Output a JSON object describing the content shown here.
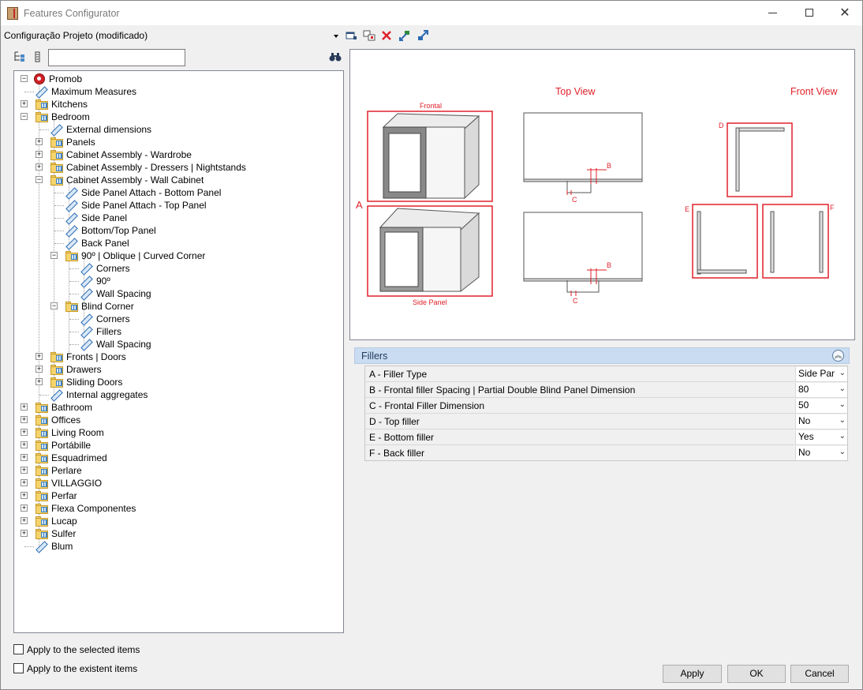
{
  "window": {
    "title": "Features Configurator"
  },
  "toolbar": {
    "profile": "Configuração Projeto (modificado)",
    "icons": [
      "configure-icon",
      "copy-icon",
      "delete-icon",
      "import-icon",
      "export-icon"
    ]
  },
  "search": {
    "value": "",
    "placeholder": ""
  },
  "tree": {
    "root": "Promob",
    "items": [
      {
        "label": "Maximum Measures"
      },
      {
        "label": "Kitchens"
      },
      {
        "label": "Bedroom"
      },
      {
        "label": "External dimensions"
      },
      {
        "label": "Panels"
      },
      {
        "label": "Cabinet Assembly - Wardrobe"
      },
      {
        "label": "Cabinet Assembly - Dressers | Nightstands"
      },
      {
        "label": "Cabinet Assembly - Wall Cabinet"
      },
      {
        "label": "Side Panel Attach - Bottom Panel"
      },
      {
        "label": " Side Panel Attach - Top Panel"
      },
      {
        "label": "Side Panel"
      },
      {
        "label": "Bottom/Top Panel"
      },
      {
        "label": "Back Panel"
      },
      {
        "label": "90º | Oblique | Curved Corner"
      },
      {
        "label": "Corners"
      },
      {
        "label": "90º"
      },
      {
        "label": "Wall Spacing"
      },
      {
        "label": "Blind Corner"
      },
      {
        "label": "Corners"
      },
      {
        "label": "Fillers"
      },
      {
        "label": "Wall Spacing"
      },
      {
        "label": "Fronts | Doors"
      },
      {
        "label": "Drawers"
      },
      {
        "label": "Sliding Doors"
      },
      {
        "label": "Internal aggregates"
      },
      {
        "label": "Bathroom"
      },
      {
        "label": "Offices"
      },
      {
        "label": "Living Room"
      },
      {
        "label": "Portábille"
      },
      {
        "label": "Esquadrimed"
      },
      {
        "label": "Perlare"
      },
      {
        "label": "VILLAGGIO"
      },
      {
        "label": "Perfar"
      },
      {
        "label": "Flexa Componentes"
      },
      {
        "label": "Lucap"
      },
      {
        "label": "Sulfer"
      },
      {
        "label": "Blum"
      }
    ]
  },
  "options": {
    "apply_selected": "Apply to the selected items",
    "apply_existent": "Apply to the existent items"
  },
  "preview": {
    "top_view": "Top View",
    "front_view": "Front View",
    "frontal": "Frontal",
    "side_panel": "Side Panel",
    "label_a": "A",
    "label_b": "B",
    "label_c": "C",
    "label_d": "D",
    "label_e": "E",
    "label_f": "F",
    "accent_color": "#e0202a"
  },
  "properties": {
    "section": "Fillers",
    "rows": [
      {
        "label": "A - Filler Type",
        "value": "Side Panel"
      },
      {
        "label": "B - Frontal filler Spacing | Partial Double Blind Panel Dimension",
        "value": "80"
      },
      {
        "label": "C - Frontal Filler Dimension",
        "value": "50"
      },
      {
        "label": "D - Top filler",
        "value": "No"
      },
      {
        "label": "E - Bottom filler",
        "value": "Yes"
      },
      {
        "label": "F - Back filler",
        "value": "No"
      }
    ]
  },
  "buttons": {
    "apply": "Apply",
    "ok": "OK",
    "cancel": "Cancel"
  }
}
